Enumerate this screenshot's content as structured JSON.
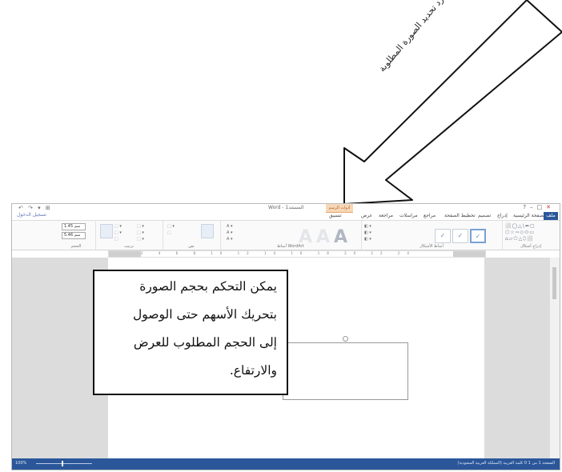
{
  "annotation_arrow": {
    "text": "يظهر صندوق تنسيق الصور بمجرد تحديد الصورة المطلوبة"
  },
  "callout": {
    "lines": [
      "يمكن التحكم بحجم الصورة",
      "بتحريك الأسهم حتى الوصول",
      "إلى الحجم المطلوب للعرض",
      "والارتفاع."
    ]
  },
  "word_window": {
    "title": "Word - المستند1",
    "contextual_tab_group": "أدوات الرسم",
    "quick_access": "↶ ↷ ▾ ⊞",
    "tabs": [
      "ملف",
      "الصفحة الرئيسية",
      "إدراج",
      "تصميم",
      "تخطيط الصفحة",
      "مراجع",
      "مراسلات",
      "مراجعة",
      "عرض",
      "تنسيق"
    ],
    "user": "تسجيل الدخول",
    "size_group": {
      "label": "الحجم",
      "height_value": "1.45 سم",
      "width_value": "5.46 سم"
    },
    "ribbon_groups": {
      "arrange": "ترتيب",
      "text": "نص",
      "wordart_styles": "أنماط WordArt",
      "shape_styles": "أنماط الأشكال",
      "insert_shapes": "إدراج أشكال"
    },
    "wordart_letter": "A",
    "style_glyph": "✓",
    "shape_grid": "⬜◯△\\⬅▢\n⬡☆⇨◇⬭▭\n⌂▱⬠△⬯⬜",
    "ruler_ticks": "2 4 6 8 10 12 14 16 18 20 22 24",
    "status_left": "100%",
    "status_right": "الصفحة 1 من 1   0 كلمة   العربية (المملكة العربية السعودية)",
    "layout_options_glyph": "≡"
  },
  "colors": {
    "accent": "#2b579a",
    "contextual_tab": "#f6d8b8",
    "page": "#ffffff",
    "canvas": "#dcdcdc"
  }
}
